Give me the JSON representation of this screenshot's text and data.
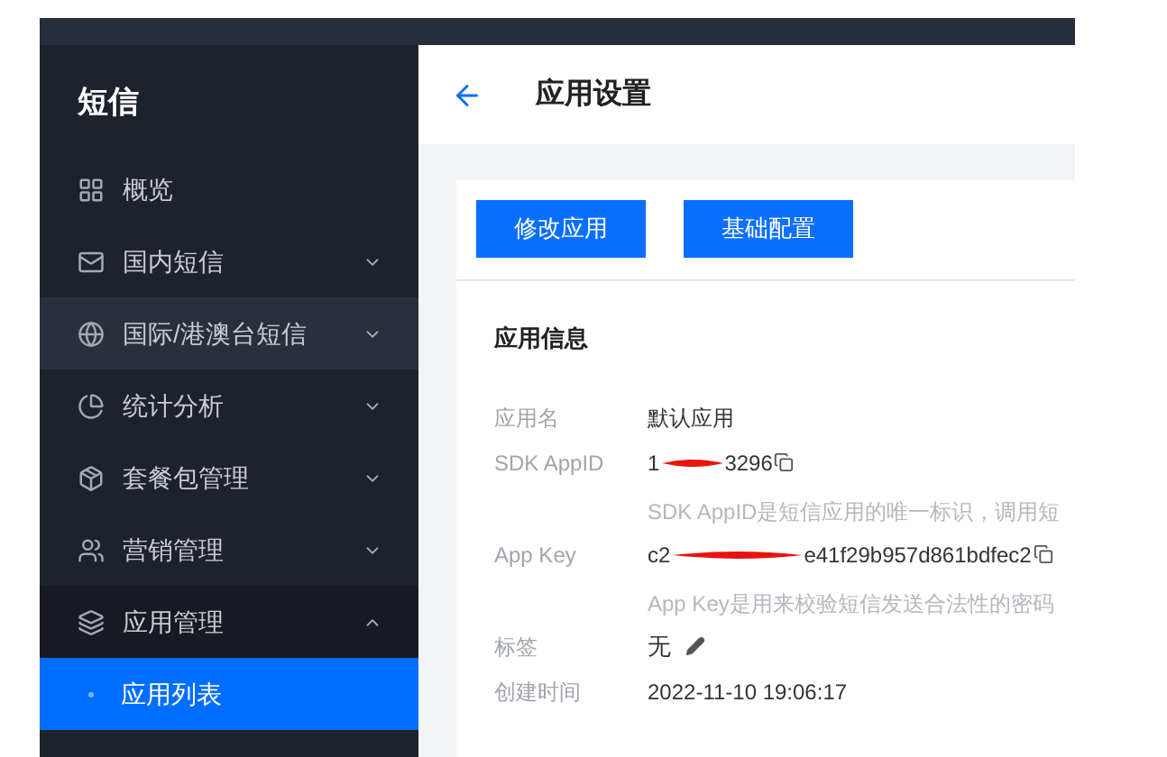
{
  "sidebar": {
    "title": "短信",
    "items": [
      {
        "label": "概览",
        "highlighted": false
      },
      {
        "label": "国内短信",
        "highlighted": false,
        "expanded": false
      },
      {
        "label": "国际/港澳台短信",
        "highlighted": true,
        "expanded": false
      },
      {
        "label": "统计分析",
        "highlighted": false,
        "expanded": false
      },
      {
        "label": "套餐包管理",
        "highlighted": false,
        "expanded": false
      },
      {
        "label": "营销管理",
        "highlighted": false,
        "expanded": false
      },
      {
        "label": "应用管理",
        "highlighted": false,
        "expanded": true,
        "children": [
          {
            "label": "应用列表",
            "selected": true
          }
        ]
      }
    ]
  },
  "header": {
    "title": "应用设置"
  },
  "buttons": [
    "修改应用",
    "基础配置"
  ],
  "section_title": "应用信息",
  "fields": [
    {
      "kind": "text",
      "label": "应用名",
      "value": "默认应用"
    },
    {
      "kind": "secret",
      "label": "SDK AppID",
      "value_start": "1",
      "value_end": "3296",
      "hint": "SDK AppID是短信应用的唯一标识，调用短"
    },
    {
      "kind": "secret",
      "label": "App Key",
      "value_start": "c2",
      "value_end": "e41f29b957d861bdfec2",
      "hint": "App Key是用来校验短信发送合法性的密码"
    },
    {
      "kind": "editable",
      "label": "标签",
      "value": "无"
    },
    {
      "kind": "text",
      "label": "创建时间",
      "value": "2022-11-10 19:06:17"
    }
  ]
}
